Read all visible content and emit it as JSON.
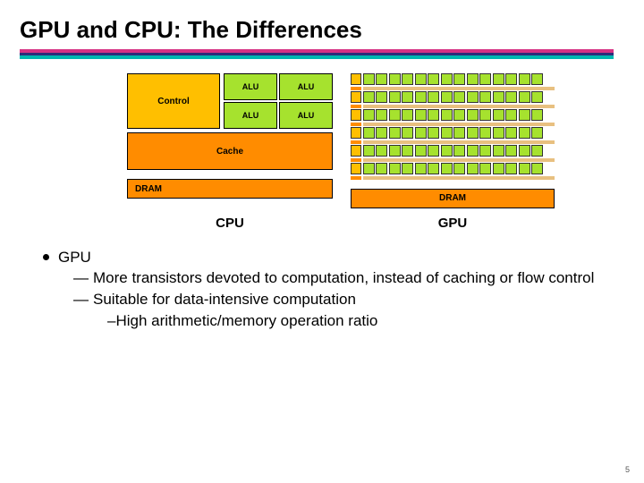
{
  "title": "GPU and CPU: The Differences",
  "cpu": {
    "control": "Control",
    "alu": "ALU",
    "cache": "Cache",
    "dram": "DRAM",
    "label": "CPU"
  },
  "gpu": {
    "dram": "DRAM",
    "label": "GPU",
    "alu_cols": 14,
    "rows": 6
  },
  "bullets": {
    "b0": "GPU",
    "d1": "More transistors devoted to computation, instead of caching or flow control",
    "d2": "Suitable for data-intensive computation",
    "s1": "High arithmetic/memory operation ratio"
  },
  "glyph": {
    "dash": "—",
    "hyph": "–"
  },
  "page": "5"
}
